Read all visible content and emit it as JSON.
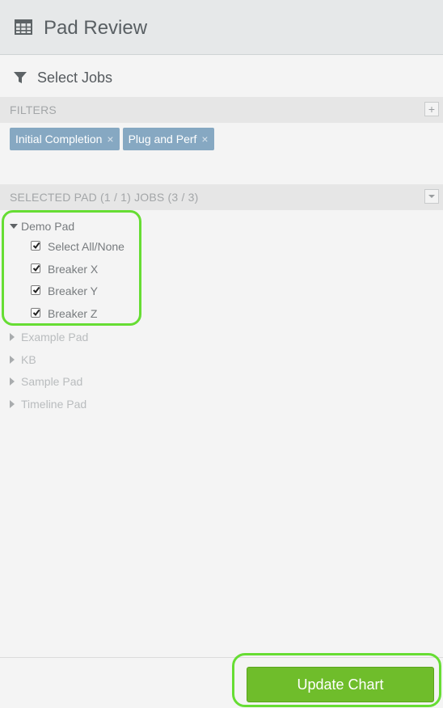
{
  "header": {
    "title": "Pad Review",
    "icon": "table-icon"
  },
  "select_jobs": {
    "label": "Select Jobs",
    "icon": "filter-icon"
  },
  "filters": {
    "label": "FILTERS",
    "add_button": "+",
    "tags": [
      {
        "label": "Initial Completion",
        "remove": "×"
      },
      {
        "label": "Plug and Perf",
        "remove": "×"
      }
    ]
  },
  "selected": {
    "label": "SELECTED PAD (1 / 1) JOBS (3 / 3)",
    "dropdown_icon": "caret-down-icon"
  },
  "tree": {
    "expanded_pad": {
      "label": "Demo Pad",
      "select_all": "Select All/None",
      "jobs": [
        {
          "label": "Breaker X",
          "checked": true
        },
        {
          "label": "Breaker Y",
          "checked": true
        },
        {
          "label": "Breaker Z",
          "checked": true
        }
      ]
    },
    "collapsed_pads": [
      "Example Pad",
      "KB",
      "Sample Pad",
      "Timeline Pad"
    ]
  },
  "footer": {
    "update_button": "Update Chart"
  },
  "colors": {
    "accent_green": "#6fbd2b",
    "tag_blue": "#86a8c2",
    "highlight": "#66dd33"
  }
}
